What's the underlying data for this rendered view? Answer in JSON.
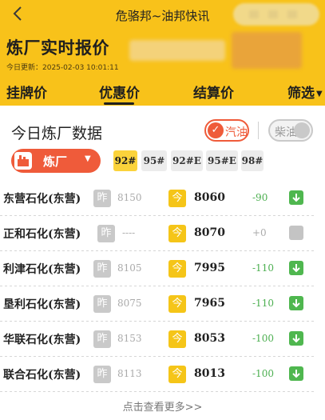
{
  "topbar": {
    "back_icon": "chevron-left-icon",
    "title": "危骆邦~油邦快讯"
  },
  "header": {
    "title": "炼厂实时报价",
    "update_time": "今日更新：2025-02-03 10:01:11"
  },
  "tabs": [
    {
      "label": "挂牌价",
      "active": false
    },
    {
      "label": "优惠价",
      "active": true
    },
    {
      "label": "结算价",
      "active": false
    },
    {
      "label": "筛选",
      "active": false
    }
  ],
  "section": {
    "title": "今日炼厂数据",
    "gasoline_label": "汽油",
    "diesel_label": "柴油"
  },
  "refinery_selector": {
    "label": "炼厂"
  },
  "grades": [
    {
      "label": "92#",
      "active": true
    },
    {
      "label": "95#",
      "active": false
    },
    {
      "label": "92#E",
      "active": false
    },
    {
      "label": "95#E",
      "active": false
    },
    {
      "label": "98#",
      "active": false
    }
  ],
  "labels": {
    "yesterday": "昨",
    "today": "今"
  },
  "rows": [
    {
      "name": "东营石化(东营)",
      "yesterday": "8150",
      "today": "8060",
      "change": "-90",
      "trend": "down"
    },
    {
      "name": "正和石化(东营)",
      "yesterday": "----",
      "today": "8070",
      "change": "+0",
      "trend": "flat"
    },
    {
      "name": "利津石化(东营)",
      "yesterday": "8105",
      "today": "7995",
      "change": "-110",
      "trend": "down"
    },
    {
      "name": "垦利石化(东营)",
      "yesterday": "8075",
      "today": "7965",
      "change": "-110",
      "trend": "down"
    },
    {
      "name": "华联石化(东营)",
      "yesterday": "8153",
      "today": "8053",
      "change": "-100",
      "trend": "down"
    },
    {
      "name": "联合石化(东营)",
      "yesterday": "8113",
      "today": "8013",
      "change": "-100",
      "trend": "down"
    }
  ],
  "more_link": "点击查看更多>>",
  "colors": {
    "header_bg": "#f8c21a",
    "accent_red": "#ef5b3a",
    "down_green": "#4fb74f",
    "today_badge": "#f5c518"
  }
}
